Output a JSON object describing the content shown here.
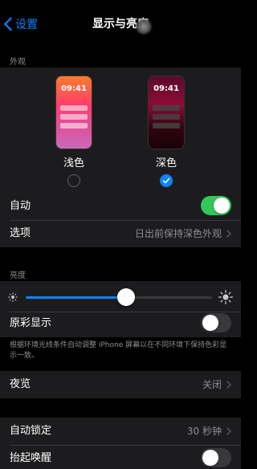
{
  "nav": {
    "back_label": "设置",
    "title": "显示与亮度"
  },
  "appearance": {
    "header": "外观",
    "light": {
      "label": "浅色",
      "time": "09:41",
      "selected": false
    },
    "dark": {
      "label": "深色",
      "time": "09:41",
      "selected": true
    },
    "auto": {
      "label": "自动",
      "on": true
    },
    "options": {
      "label": "选项",
      "value": "日出前保持深色外观"
    }
  },
  "brightness": {
    "header": "亮度",
    "level": 0.54,
    "true_tone": {
      "label": "原彩显示",
      "on": false
    },
    "footnote": "根据环境光线条件自动调整 iPhone 屏幕以在不同环境下保持色彩显示一致。"
  },
  "night_shift": {
    "label": "夜览",
    "value": "关闭"
  },
  "auto_lock": {
    "label": "自动锁定",
    "value": "30 秒钟"
  },
  "raise_to_wake": {
    "label": "抬起唤醒",
    "on": false
  },
  "colors": {
    "accent": "#0a84ff",
    "toggle_on": "#34c759",
    "background": "#000000",
    "cell": "#1c1c1e"
  }
}
